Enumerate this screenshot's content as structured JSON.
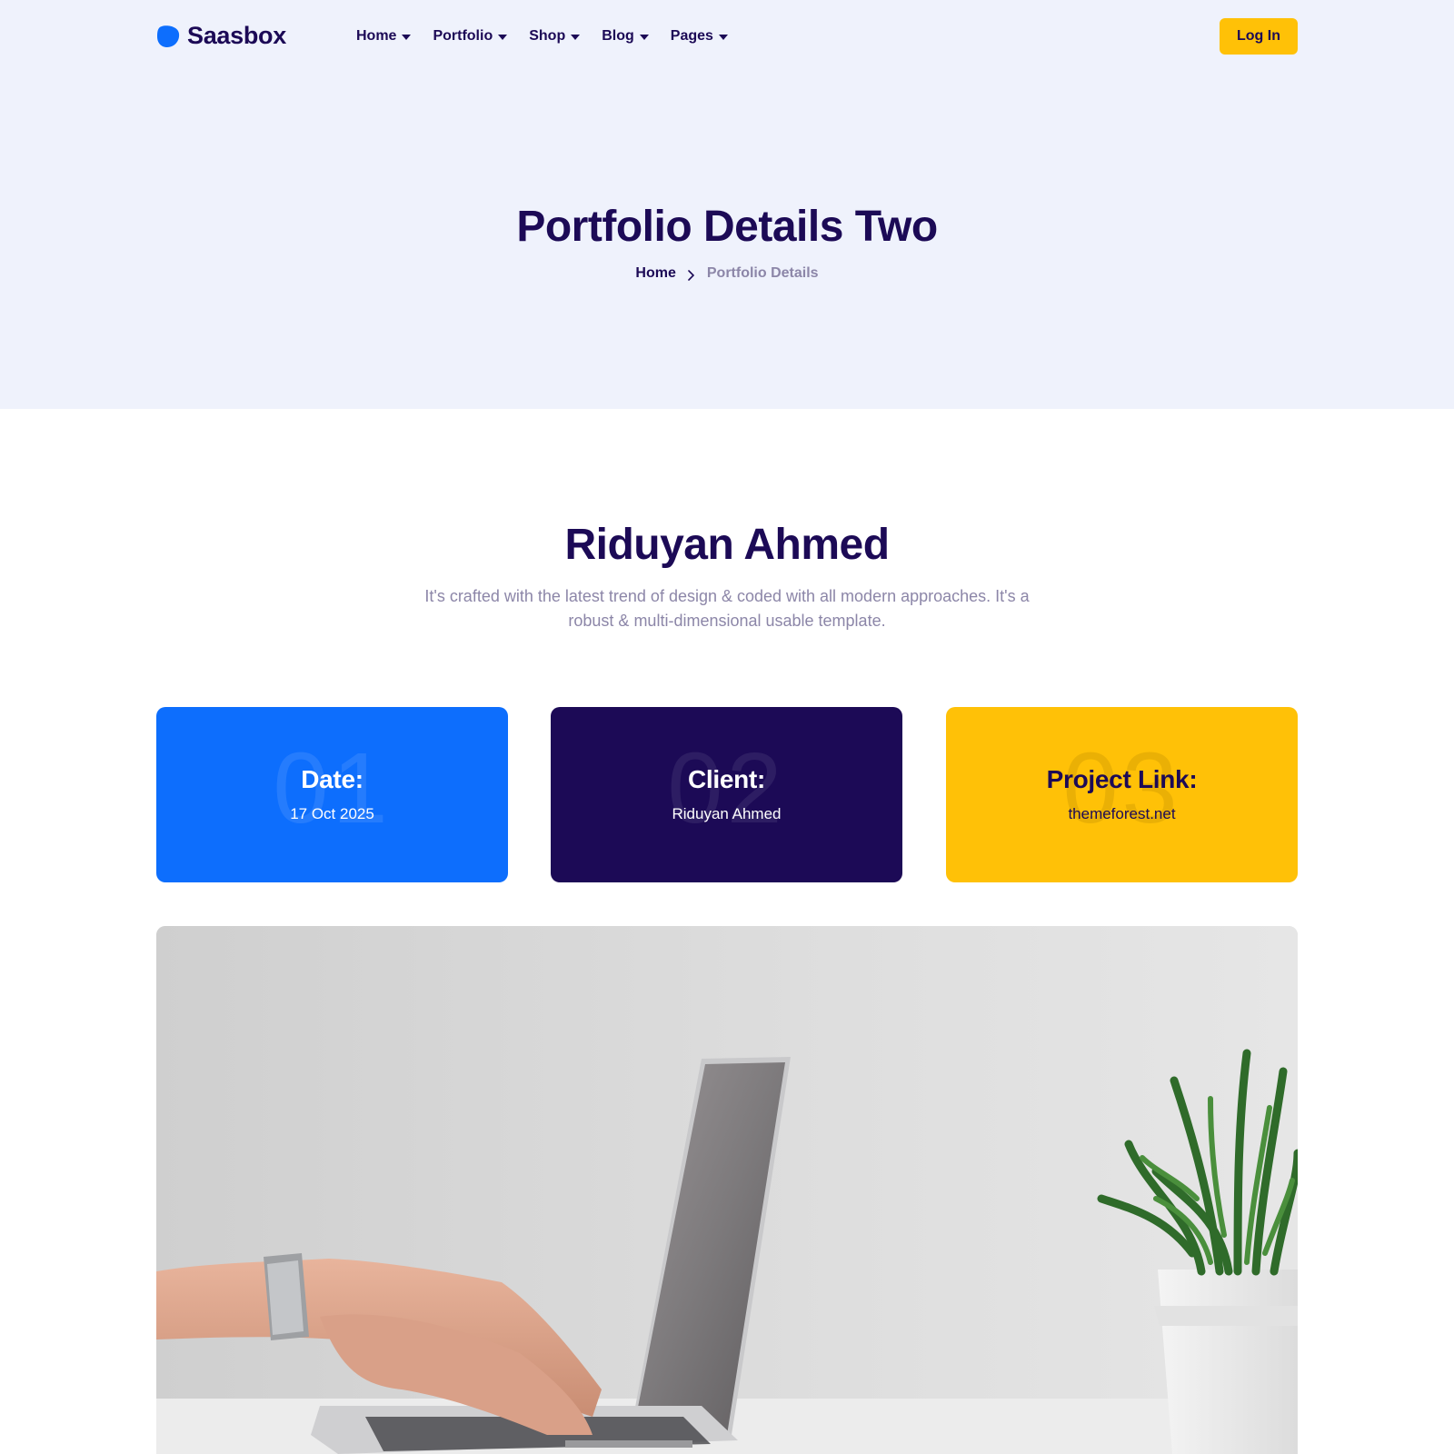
{
  "brand": {
    "name": "Saasbox"
  },
  "nav": {
    "items": [
      {
        "label": "Home"
      },
      {
        "label": "Portfolio"
      },
      {
        "label": "Shop"
      },
      {
        "label": "Blog"
      },
      {
        "label": "Pages"
      }
    ],
    "login_label": "Log In"
  },
  "hero": {
    "title": "Portfolio Details Two",
    "breadcrumb": {
      "home": "Home",
      "current": "Portfolio Details"
    }
  },
  "project": {
    "title": "Riduyan Ahmed",
    "description": "It's crafted with the latest trend of design & coded with all modern approaches. It's a robust & multi-dimensional usable template."
  },
  "cards": [
    {
      "number": "01",
      "label": "Date:",
      "value": "17 Oct 2025"
    },
    {
      "number": "02",
      "label": "Client:",
      "value": "Riduyan Ahmed"
    },
    {
      "number": "03",
      "label": "Project Link:",
      "value": "themeforest.net"
    }
  ],
  "colors": {
    "primary_navy": "#1c0a56",
    "accent_blue": "#0d6efd",
    "accent_yellow": "#ffc107",
    "hero_bg": "#eff2fc",
    "muted_text": "#8c86a8"
  },
  "icons": {
    "logo": "blob-logo-icon",
    "dropdown": "caret-down-icon",
    "breadcrumb_separator": "chevron-right-icon"
  }
}
